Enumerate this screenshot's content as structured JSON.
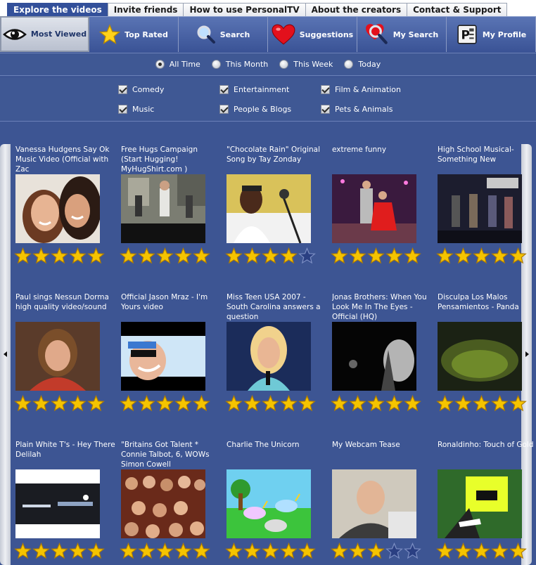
{
  "tabs": [
    "Explore the videos",
    "Invite friends",
    "How to use PersonalTV",
    "About the creators",
    "Contact & Support"
  ],
  "toolbar": [
    {
      "label": "Most Viewed",
      "icon": "eye-icon"
    },
    {
      "label": "Top Rated",
      "icon": "star-icon"
    },
    {
      "label": "Search",
      "icon": "magnifier-icon"
    },
    {
      "label": "Suggestions",
      "icon": "heart-icon"
    },
    {
      "label": "My Search",
      "icon": "heart-magnifier-icon"
    },
    {
      "label": "My Profile",
      "icon": "profile-card-icon"
    }
  ],
  "time_filters": {
    "options": [
      "All Time",
      "This Month",
      "This Week",
      "Today"
    ],
    "selected": "All Time"
  },
  "categories": [
    {
      "label": "Comedy",
      "checked": true
    },
    {
      "label": "Entertainment",
      "checked": true
    },
    {
      "label": "Film & Animation",
      "checked": true
    },
    {
      "label": "Music",
      "checked": true
    },
    {
      "label": "People & Blogs",
      "checked": true
    },
    {
      "label": "Pets & Animals",
      "checked": true
    }
  ],
  "colors": {
    "panel": "#3d5593",
    "star": "#f5c400",
    "star_empty": "#2a3f82"
  },
  "videos": [
    {
      "title": "Vanessa Hudgens Say Ok Music Video (Official with Zac",
      "rating": 5,
      "thumb": "girls-smiling"
    },
    {
      "title": "Free Hugs Campaign (Start Hugging! MyHugShirt.com )",
      "rating": 5,
      "thumb": "street-crowd"
    },
    {
      "title": "\"Chocolate Rain\" Original Song by Tay Zonday",
      "rating": 4,
      "thumb": "singer-microphone"
    },
    {
      "title": "extreme funny",
      "rating": 5,
      "thumb": "stage-performance"
    },
    {
      "title": "High School Musical-Something New",
      "rating": 5,
      "thumb": "stage-crowd"
    },
    {
      "title": "Paul sings Nessun Dorma high quality video/sound",
      "rating": 5,
      "thumb": "judge-woman"
    },
    {
      "title": "Official Jason Mraz - I'm Yours video",
      "rating": 5,
      "thumb": "sunglasses-man"
    },
    {
      "title": "Miss Teen USA 2007 - South Carolina answers a question",
      "rating": 5,
      "thumb": "pageant-contestant"
    },
    {
      "title": "Jonas Brothers: When You Look Me In The Eyes - Official (HQ)",
      "rating": 5,
      "thumb": "dark-scene"
    },
    {
      "title": "Disculpa Los Malos Pensamientos - Panda",
      "rating": 5,
      "thumb": "green-dark"
    },
    {
      "title": "Plain White T's - Hey There Delilah",
      "rating": 5,
      "thumb": "city-night"
    },
    {
      "title": "\"Britains Got Talent * Connie Talbot, 6, WOWs Simon Cowell",
      "rating": 5,
      "thumb": "audience"
    },
    {
      "title": "Charlie The Unicorn",
      "rating": 5,
      "thumb": "unicorns-cartoon"
    },
    {
      "title": "My Webcam Tease",
      "rating": 3,
      "thumb": "webcam-man"
    },
    {
      "title": "Ronaldinho:  Touch of Gold",
      "rating": 5,
      "thumb": "football-player"
    }
  ]
}
